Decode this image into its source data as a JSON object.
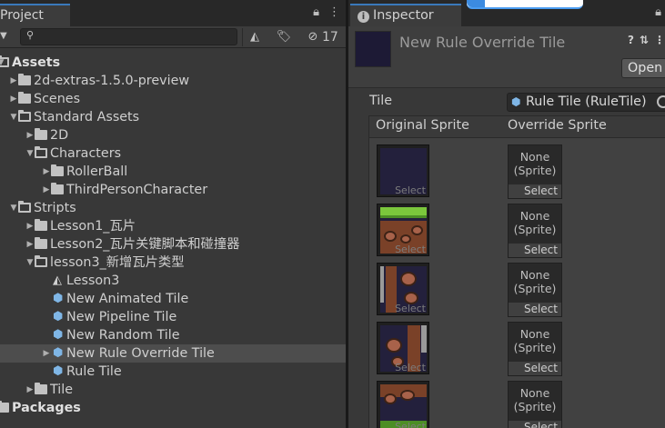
{
  "project": {
    "tab_label": "Project",
    "hidden_count": "17",
    "search": {
      "placeholder": "",
      "value": ""
    },
    "tree": [
      {
        "label": "Assets",
        "depth": 0,
        "expanded": true,
        "kind": "folder",
        "bold": true
      },
      {
        "label": "2d-extras-1.5.0-preview",
        "depth": 1,
        "expanded": false,
        "kind": "folder"
      },
      {
        "label": "Scenes",
        "depth": 1,
        "expanded": false,
        "kind": "folder"
      },
      {
        "label": "Standard Assets",
        "depth": 1,
        "expanded": true,
        "kind": "folder"
      },
      {
        "label": "2D",
        "depth": 2,
        "expanded": false,
        "kind": "folder"
      },
      {
        "label": "Characters",
        "depth": 2,
        "expanded": true,
        "kind": "folder"
      },
      {
        "label": "RollerBall",
        "depth": 3,
        "expanded": false,
        "kind": "folder"
      },
      {
        "label": "ThirdPersonCharacter",
        "depth": 3,
        "expanded": false,
        "kind": "folder"
      },
      {
        "label": "Stripts",
        "depth": 1,
        "expanded": true,
        "kind": "folder"
      },
      {
        "label": "Lesson1_瓦片",
        "depth": 2,
        "expanded": false,
        "kind": "folder"
      },
      {
        "label": "Lesson2_瓦片关键脚本和碰撞器",
        "depth": 2,
        "expanded": false,
        "kind": "folder"
      },
      {
        "label": "lesson3_新增瓦片类型",
        "depth": 2,
        "expanded": true,
        "kind": "folder"
      },
      {
        "label": "Lesson3",
        "depth": 3,
        "kind": "unity"
      },
      {
        "label": "New Animated Tile",
        "depth": 3,
        "kind": "tile"
      },
      {
        "label": "New Pipeline Tile",
        "depth": 3,
        "kind": "tile"
      },
      {
        "label": "New Random Tile",
        "depth": 3,
        "kind": "tile"
      },
      {
        "label": "New Rule Override Tile",
        "depth": 3,
        "kind": "tile",
        "selected": true,
        "has_arrow": true
      },
      {
        "label": "Rule Tile",
        "depth": 3,
        "kind": "tile"
      },
      {
        "label": "Tile",
        "depth": 2,
        "expanded": false,
        "kind": "folder"
      },
      {
        "label": "Packages",
        "depth": 0,
        "expanded": false,
        "kind": "folder",
        "bold": true
      }
    ]
  },
  "inspector": {
    "tab_label": "Inspector",
    "asset_title": "New Rule Override Tile",
    "open_button": "Open",
    "tile_label": "Tile",
    "tile_value": "Rule Tile (RuleTile)",
    "columns": {
      "original": "Original Sprite",
      "override": "Override Sprite"
    },
    "select_label": "Select",
    "override_none": "None",
    "override_type": "(Sprite)",
    "entries": [
      {
        "sprite": "dark"
      },
      {
        "sprite": "grass"
      },
      {
        "sprite": "rocks-left"
      },
      {
        "sprite": "rocks-mid"
      },
      {
        "sprite": "rocks-top"
      }
    ]
  },
  "colors": {
    "panel": "#383838",
    "tab_accent": "#3a79bb",
    "selection": "#4d4d4d",
    "sprite_bg": "#23203c"
  }
}
